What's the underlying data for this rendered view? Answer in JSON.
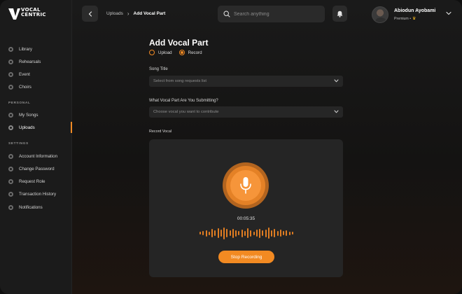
{
  "app": {
    "logo_text": "VOCAL\nCENTRIC"
  },
  "sidebar": {
    "main_items": [
      {
        "label": "Library",
        "icon": "library-icon"
      },
      {
        "label": "Rehearsals",
        "icon": "rehearsals-icon"
      },
      {
        "label": "Event",
        "icon": "event-icon"
      },
      {
        "label": "Choirs",
        "icon": "choirs-icon"
      }
    ],
    "personal_label": "PERSONAL",
    "personal_items": [
      {
        "label": "My Songs",
        "icon": "music-icon"
      },
      {
        "label": "Uploads",
        "icon": "upload-icon",
        "active": true
      }
    ],
    "settings_label": "SETTINGS",
    "settings_items": [
      {
        "label": "Account Information",
        "icon": "account-icon"
      },
      {
        "label": "Change Password",
        "icon": "lock-icon"
      },
      {
        "label": "Request Role",
        "icon": "role-icon"
      },
      {
        "label": "Transaction History",
        "icon": "history-icon"
      },
      {
        "label": "Notifications",
        "icon": "notification-icon"
      }
    ]
  },
  "header": {
    "breadcrumb_parent": "Uploads",
    "breadcrumb_separator": "›",
    "breadcrumb_current": "Add Vocal Part",
    "search_placeholder": "Search anything",
    "user_name": "Abiodun Ayobami",
    "user_plan": "Premium •",
    "plan_badge_icon": "crown-icon"
  },
  "form": {
    "title": "Add Vocal Part",
    "mode_options": [
      {
        "label": "Upload",
        "checked": false
      },
      {
        "label": "Record",
        "checked": true
      }
    ],
    "song_title_label": "Song Title",
    "song_title_placeholder": "Select from song requests list",
    "vocal_part_label": "What Vocal Part Are You Submitting?",
    "vocal_part_placeholder": "Choose vocal you want to contribute",
    "record_label": "Record Vocal"
  },
  "recorder": {
    "timer": "00:05:35",
    "stop_label": "Stop Recording",
    "accent_color": "#F28A22"
  }
}
